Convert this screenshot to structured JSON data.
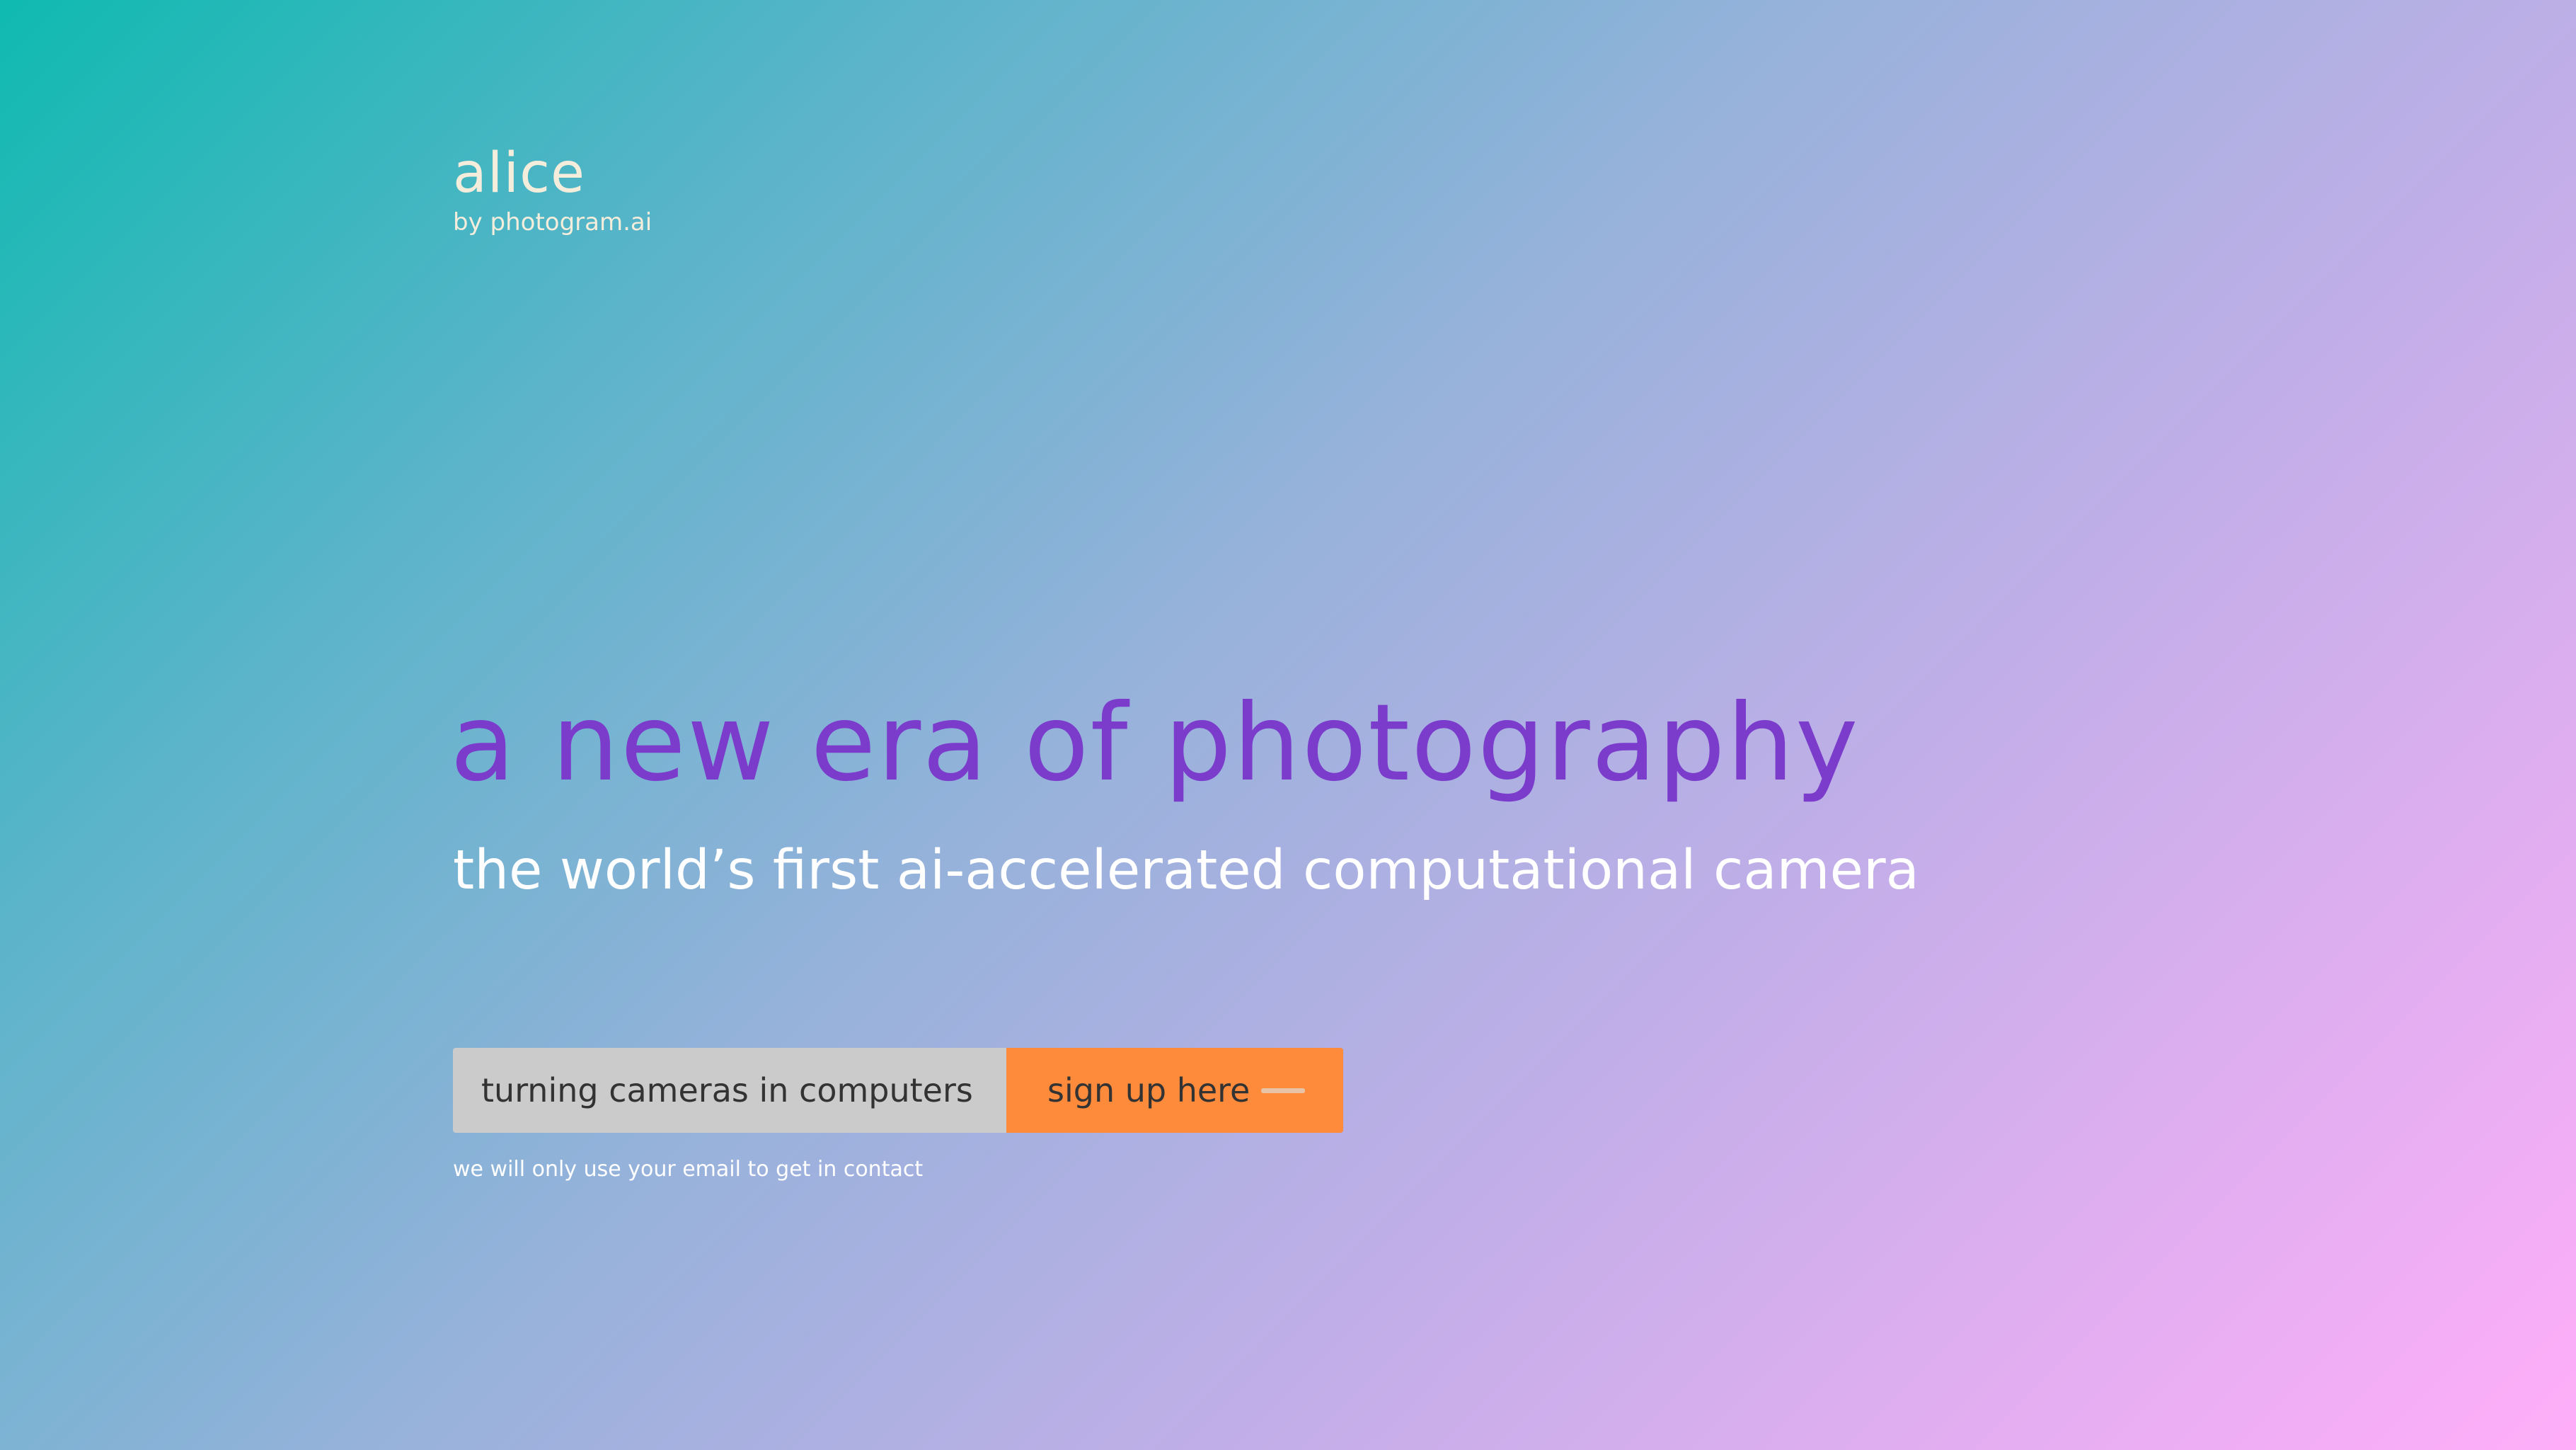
{
  "brand": {
    "name": "alice",
    "byline": "by photogram.ai"
  },
  "hero": {
    "headline": "a new era of photography",
    "subheadline": "the world’s first ai-accelerated computational camera"
  },
  "signup": {
    "email_placeholder": "turning cameras in computers",
    "button_label": "sign up here",
    "button_icon": "dash-icon",
    "note": "we will only use your email to get in contact"
  },
  "colors": {
    "gradient_start": "#0fbab0",
    "gradient_end": "#ffaef8",
    "headline": "#7b3ccc",
    "brand_text": "#f4eddc",
    "button": "#fe8b3c",
    "input": "#cbcbcb"
  }
}
